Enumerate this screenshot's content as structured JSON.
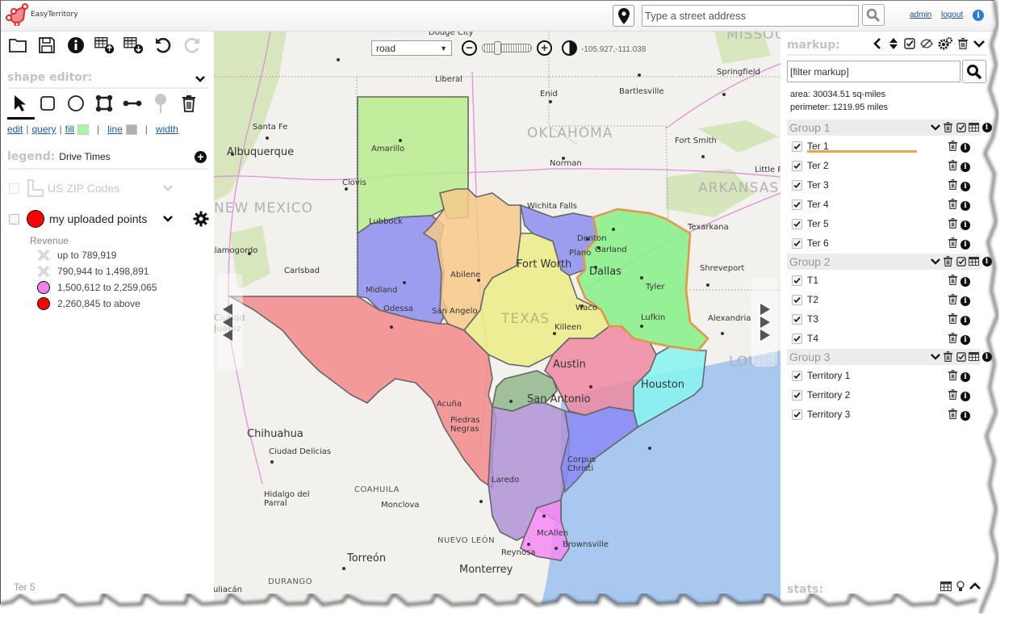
{
  "app": {
    "name": "EasyTerritory",
    "brand_color": "#e8262b"
  },
  "header": {
    "address_placeholder": "Type a street address",
    "admin_label": "admin",
    "logout_label": "logout"
  },
  "left_panel": {
    "toolbar_icons": [
      "open-folder-icon",
      "save-icon",
      "info-icon",
      "table-upload-icon",
      "table-download-icon",
      "undo-icon",
      "redo-icon"
    ],
    "shape_editor": {
      "title": "shape editor:",
      "tools": [
        "select-arrow-icon",
        "rectangle-icon",
        "circle-icon",
        "polygon-icon",
        "line-icon",
        "pushpin-icon",
        "trash-icon"
      ],
      "links": {
        "edit": "edit",
        "query": "query",
        "fill": "fill",
        "line": "line",
        "width": "width",
        "separator": "|"
      },
      "fill_color": "#a8f5a2",
      "line_color": "#b0b0b0"
    },
    "legend": {
      "title": "legend:",
      "subtitle": "Drive Times"
    },
    "layers": [
      {
        "name": "US ZIP Codes",
        "checked": false,
        "disabled": true
      },
      {
        "name": "my uploaded points",
        "checked": false,
        "disabled": false,
        "color": "#ff0000"
      }
    ],
    "revenue": {
      "title": "Revenue",
      "items": [
        {
          "label": "up to 789,919",
          "symbol": "x-mark",
          "color": "#d9d9d9"
        },
        {
          "label": "790,944 to 1,498,891",
          "symbol": "x-mark",
          "color": "#d9d9d9"
        },
        {
          "label": "1,500,612 to 2,259,065",
          "symbol": "circle",
          "color": "#ee82ee"
        },
        {
          "label": "2,260,845 to above",
          "symbol": "circle",
          "color": "#ff0000"
        }
      ]
    },
    "status": "Ter 5"
  },
  "map": {
    "map_type": "road",
    "coordinates": "-105.927,-111.038",
    "labels": {
      "dodge_city": "Dodge City",
      "liberal": "Liberal",
      "enid": "Enid",
      "bartlesville": "Bartlesville",
      "springfield": "Springfield",
      "missouri": "MISSOURI",
      "oklahoma": "OKLAHOMA",
      "norman": "Norman",
      "fort_smith": "Fort Smith",
      "little_rock": "Little Rock",
      "arkansas": "ARKANSAS",
      "santa_fe": "Santa Fe",
      "albuquerque": "Albuquerque",
      "amarillo": "Amarillo",
      "clovis": "Clovis",
      "new_mexico": "NEW MEXICO",
      "lubbock": "Lubbock",
      "wichita_falls": "Wichita Falls",
      "denton": "Denton",
      "plano": "Plano",
      "garland": "Garland",
      "dallas": "Dallas",
      "fort_worth": "Fort Worth",
      "texarkana": "Texarkana",
      "shreveport": "Shreveport",
      "tyler": "Tyler",
      "alamogordo": "Alamogordo",
      "abilene": "Abilene",
      "carlsbad": "Carlsbad",
      "midland": "Midland",
      "odessa": "Odessa",
      "san_angelo": "San Angelo",
      "texas": "TEXAS",
      "waco": "Waco",
      "killeen": "Killeen",
      "lufkin": "Lufkin",
      "alexandria": "Alexandria",
      "louisiana": "LOUISIANA",
      "ciudad_juarez": "Ciudad Juarez",
      "austin": "Austin",
      "houston": "Houston",
      "san_antonio": "San Antonio",
      "acuna": "Acuña",
      "piedras_negras": "Piedras Negras",
      "chihuahua": "Chihuahua",
      "ciudad_delicias": "Ciudad Delicias",
      "corpus_christi": "Corpus Christi",
      "hidalgo_del_parral": "Hidalgo del Parral",
      "coahuila": "COAHUILA",
      "monclova": "Monclova",
      "laredo": "Laredo",
      "mcallen": "McAllen",
      "brownsville": "Brownsville",
      "nuevo_leon": "NUEVO LEÓN",
      "reynosa": "Reynosa",
      "torreon": "Torreón",
      "monterrey": "Monterrey",
      "durango": "DURANGO",
      "culiacan": "Culiacán"
    },
    "territory_colors": {
      "panhandle": "#b8ec8e",
      "west_purple": "#8e8ef0",
      "central_orange": "#f7c98a",
      "north_purple": "#8e8ef0",
      "dfw_yellow": "#ecec86",
      "east_green": "#86f086",
      "far_west_red": "#f58a8a",
      "central_pink": "#f08aa0",
      "houston_cyan": "#86f5f0",
      "san_antonio_green": "#8fb88a",
      "south_purple": "#b093d6",
      "coastal_blue": "#8a8af5",
      "valley_magenta": "#f58af5",
      "water": "#a8c8f0"
    }
  },
  "right_panel": {
    "markup_title": "markup:",
    "filter_placeholder": "[filter markup]",
    "area": "area: 30034.51 sq-miles",
    "perimeter": "perimeter: 1219.95 miles",
    "selected_highlight_color": "#f0a24a",
    "groups": [
      {
        "name": "Group 1",
        "items": [
          "Ter 1",
          "Ter 2",
          "Ter 3",
          "Ter 4",
          "Ter 5",
          "Ter 6"
        ]
      },
      {
        "name": "Group 2",
        "items": [
          "T1",
          "T2",
          "T3",
          "T4"
        ]
      },
      {
        "name": "Group 3",
        "items": [
          "Territory 1",
          "Territory 2",
          "Territory 3"
        ]
      }
    ],
    "stats_title": "stats:"
  }
}
